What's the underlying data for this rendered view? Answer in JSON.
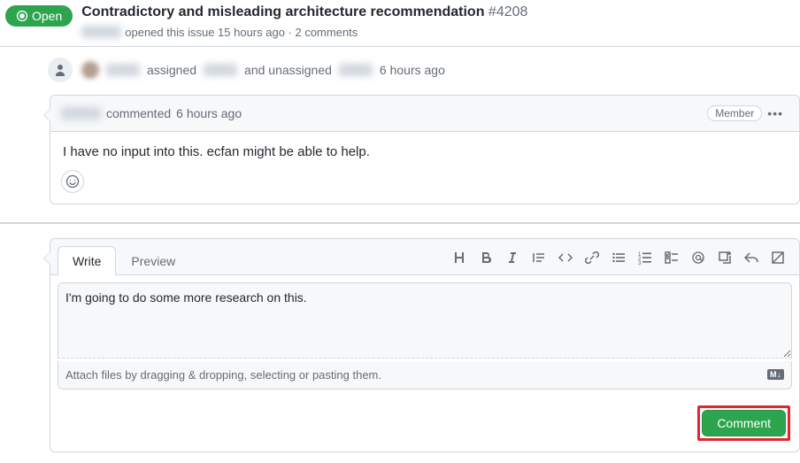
{
  "header": {
    "status": "Open",
    "title": "Contradictory and misleading architecture recommendation",
    "issue_number": "#4208",
    "opened_text": "opened this issue 15 hours ago · 2 comments"
  },
  "event": {
    "assigned": "assigned",
    "unassigned": "and unassigned",
    "time": "6 hours ago"
  },
  "comment": {
    "action": "commented",
    "time": "6 hours ago",
    "badge": "Member",
    "body": "I have no input into this. ecfan might be able to help."
  },
  "editor": {
    "tab_write": "Write",
    "tab_preview": "Preview",
    "textarea_value": "I'm going to do some more research on this.",
    "attach_hint": "Attach files by dragging & dropping, selecting or pasting them.",
    "md_label": "M↓",
    "submit": "Comment"
  }
}
